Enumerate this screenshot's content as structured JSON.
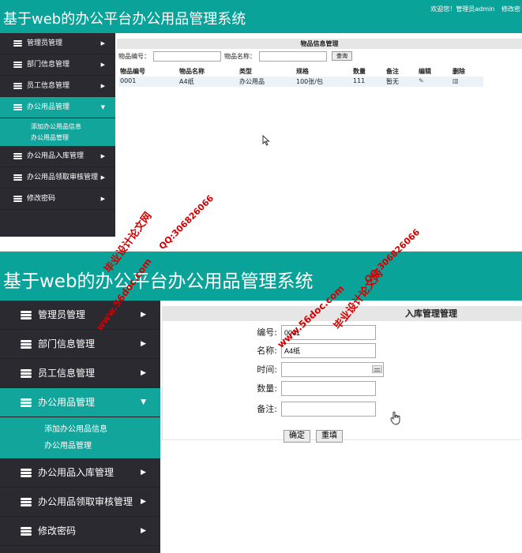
{
  "app": {
    "title": "基于web的办公平台办公用品管理系统",
    "welcome": "欢迎您！管理员admin",
    "edit_link": "修改密"
  },
  "sidebar": {
    "items": [
      {
        "label": "管理员管理"
      },
      {
        "label": "部门信息管理"
      },
      {
        "label": "员工信息管理"
      },
      {
        "label": "办公用品管理",
        "active": true
      },
      {
        "label": "办公用品入库管理"
      },
      {
        "label": "办公用品领取审核管理"
      },
      {
        "label": "修改密码"
      }
    ],
    "submenu": [
      {
        "label": "添加办公用品信息"
      },
      {
        "label": "办公用品管理"
      }
    ]
  },
  "list_view": {
    "title": "物品信息管理",
    "search": {
      "code_label": "物品编号：",
      "code_value": "",
      "name_label": "物品名称：",
      "name_value": "",
      "button": "查询"
    },
    "columns": [
      "物品编号",
      "物品名称",
      "类型",
      "规格",
      "数量",
      "备注",
      "编辑",
      "删除"
    ],
    "rows": [
      [
        "0001",
        "A4纸",
        "办公用品",
        "100张/包",
        "111",
        "暂无"
      ]
    ],
    "edit_icon": "edit-icon",
    "delete_icon": "trash-icon"
  },
  "form_view": {
    "title": "入库管理管理",
    "fields": [
      {
        "label": "编号:",
        "value": "0001"
      },
      {
        "label": "名称:",
        "value": "A4纸"
      },
      {
        "label": "时间:",
        "value": ""
      },
      {
        "label": "数量:",
        "value": ""
      },
      {
        "label": "备注:",
        "value": ""
      }
    ],
    "ok_button": "确定",
    "reset_button": "重填"
  },
  "watermark": {
    "site": "www.56doc.com",
    "qq": "QQ:306826066",
    "brand": "毕业设计论文网"
  },
  "colors": {
    "header_bg": "#0aa39a",
    "sidebar_bg": "#2a2a30",
    "active_bg": "#11a59b",
    "watermark": "#d40000"
  }
}
